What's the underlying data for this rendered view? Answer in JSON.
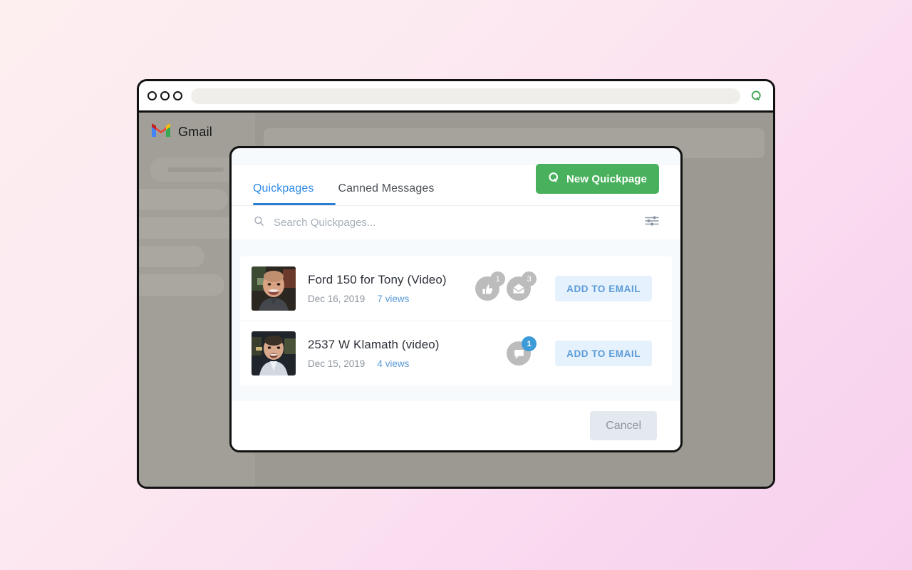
{
  "browser": {
    "url_value": "",
    "q_icon": "quickpage-logo-icon",
    "dots": [
      "window-dot",
      "window-dot",
      "window-dot"
    ]
  },
  "gmail": {
    "brand": "Gmail",
    "logo_icon": "gmail-logo-icon"
  },
  "modal": {
    "tabs": [
      {
        "label": "Quickpages",
        "active": true
      },
      {
        "label": "Canned Messages",
        "active": false
      }
    ],
    "new_quickpage_button": "New Quickpage",
    "new_quickpage_icon": "quickpage-logo-icon",
    "search": {
      "placeholder": "Search Quickpages...",
      "value": "",
      "search_icon": "search-icon",
      "filter_icon": "filter-sliders-icon"
    },
    "items": [
      {
        "title": "Ford 150 for Tony (Video)",
        "date": "Dec 16, 2019",
        "views": "7 views",
        "action": "ADD TO EMAIL",
        "stats": [
          {
            "icon": "thumbs-up-icon",
            "count": "1",
            "badge_color": "#bcbcbc"
          },
          {
            "icon": "open-envelope-icon",
            "count": "3",
            "badge_color": "#bcbcbc"
          }
        ]
      },
      {
        "title": "2537 W Klamath (video)",
        "date": "Dec 15, 2019",
        "views": "4 views",
        "action": "ADD TO EMAIL",
        "stats": [
          {
            "icon": "comment-bubble-icon",
            "count": "1",
            "badge_color": "#3d9bd8"
          }
        ]
      }
    ],
    "cancel_button": "Cancel"
  },
  "colors": {
    "accent_blue": "#2e8ae6",
    "brand_green": "#49b15d",
    "badge_blue": "#3d9bd8",
    "action_blue": "#5b9bd8"
  }
}
